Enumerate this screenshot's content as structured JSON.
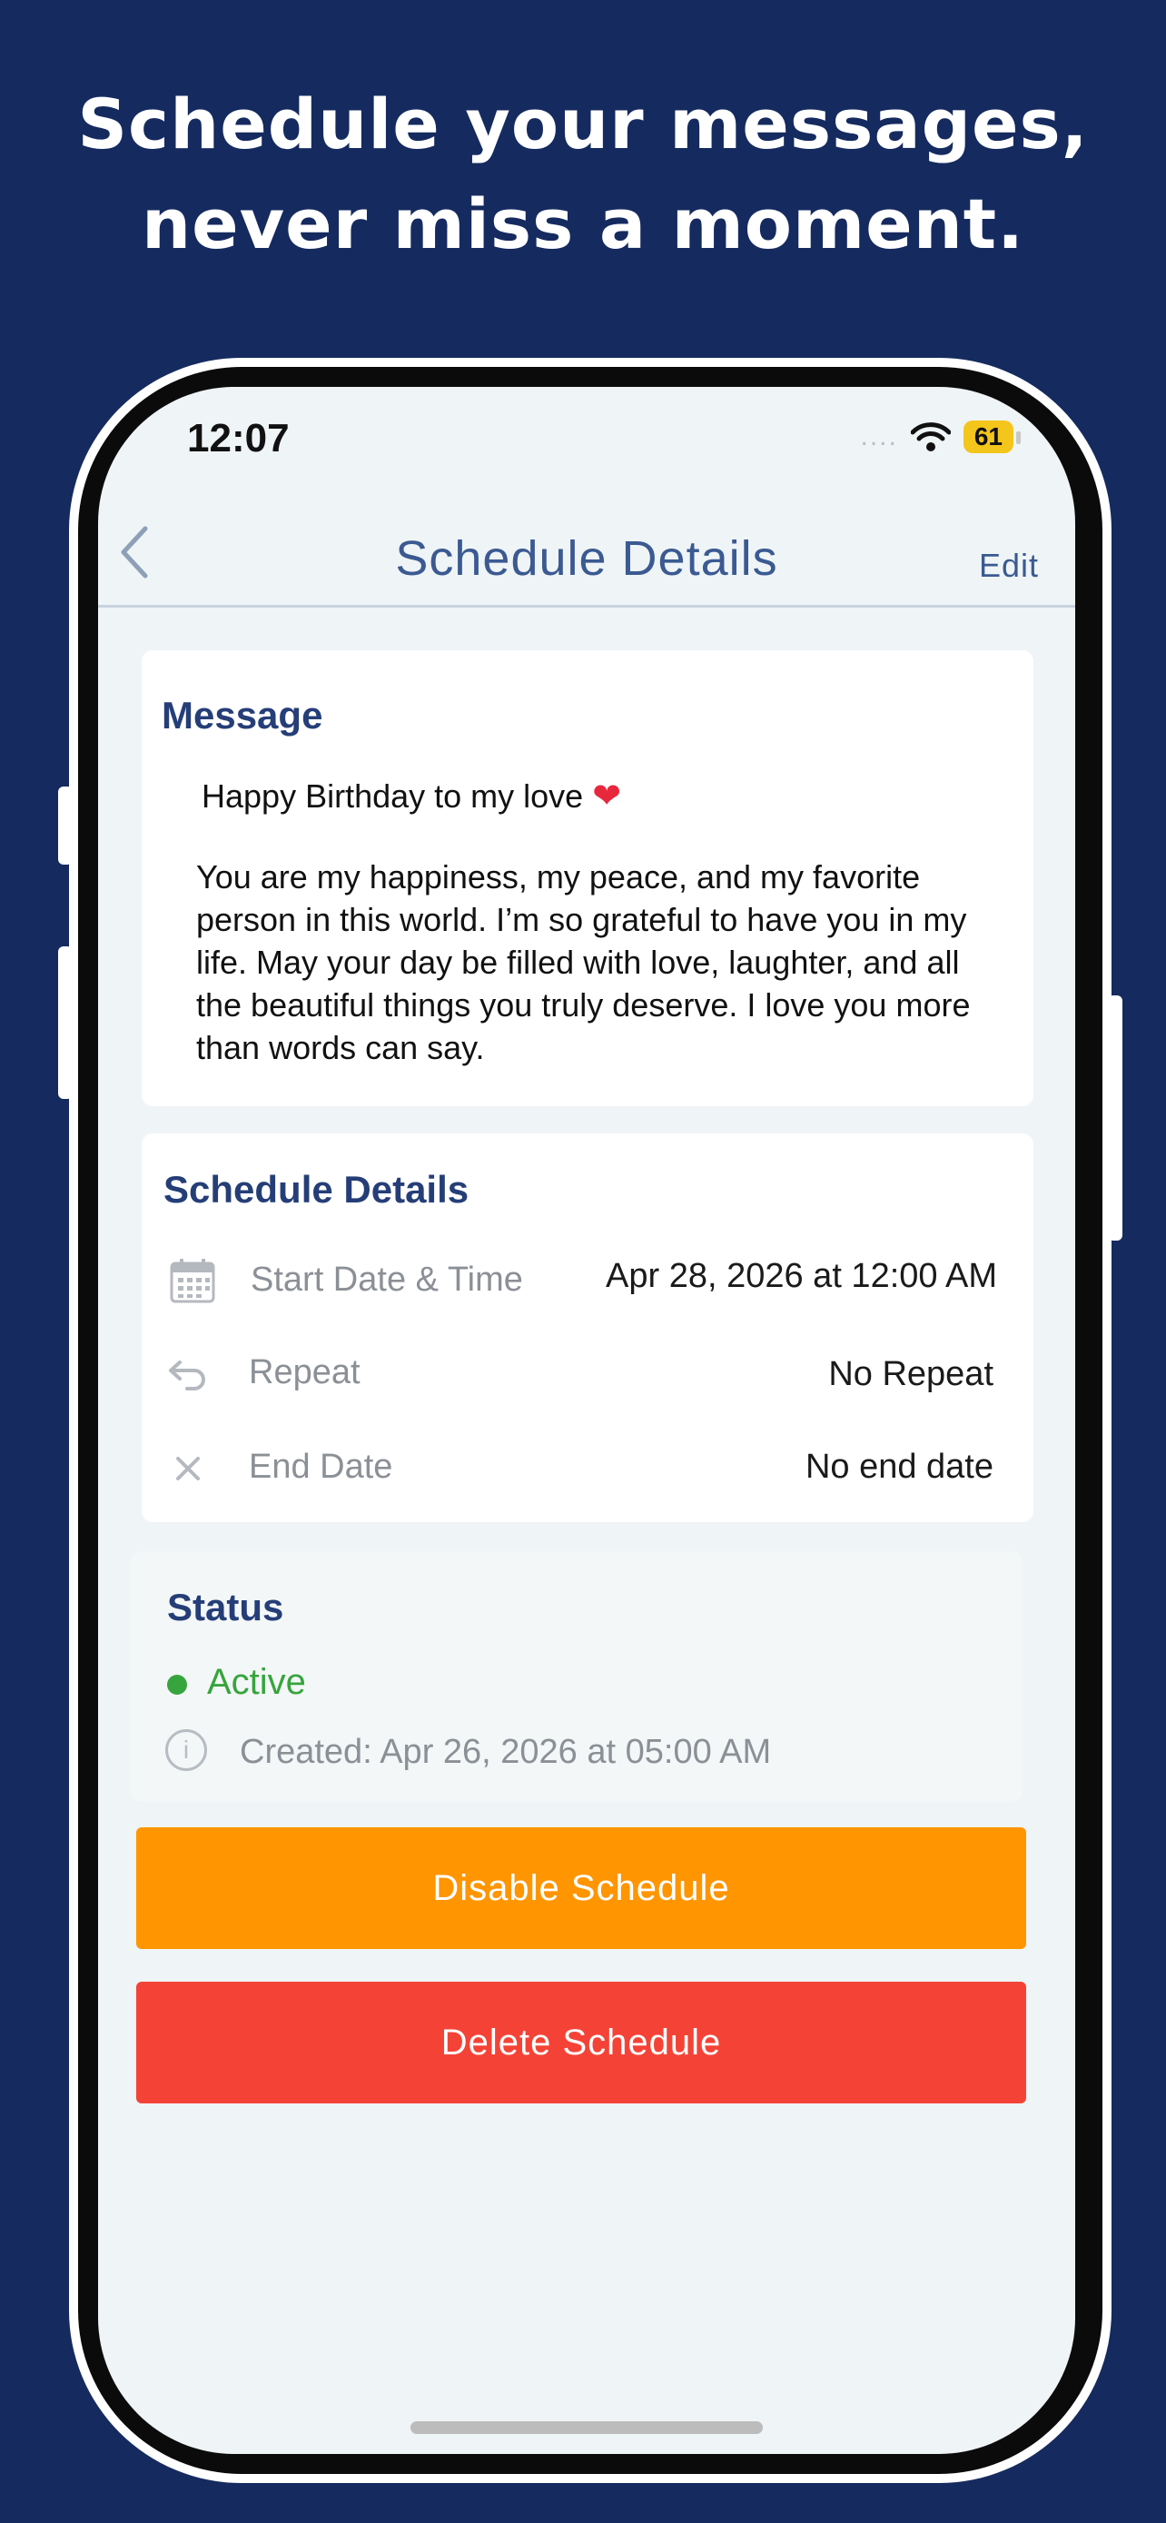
{
  "promo": {
    "headline_line1": "Schedule your messages,",
    "headline_line2": "never miss a moment."
  },
  "status_bar": {
    "time": "12:07",
    "signal": "....",
    "battery": "61"
  },
  "nav": {
    "back_icon": "chevron-left-icon",
    "title": "Schedule Details",
    "edit_label": "Edit"
  },
  "message_card": {
    "title": "Message",
    "greeting": "Happy Birthday to my love",
    "heart": "❤",
    "body": "You are my happiness, my peace, and my favorite person in this world. I’m so grateful to have you in my life. May your day be filled with love, laughter, and all the beautiful things you truly deserve. I love you more than words can say."
  },
  "schedule_card": {
    "title": "Schedule Details",
    "rows": [
      {
        "icon": "calendar-icon",
        "label": "Start Date & Time",
        "value": "Apr 28, 2026 at 12:00 AM"
      },
      {
        "icon": "repeat-icon",
        "label": "Repeat",
        "value": "No Repeat"
      },
      {
        "icon": "close-icon",
        "label": "End Date",
        "value": "No end date"
      }
    ]
  },
  "status_card": {
    "title": "Status",
    "state": "Active",
    "created": "Created: Apr 26, 2026 at 05:00 AM"
  },
  "actions": {
    "disable_label": "Disable Schedule",
    "delete_label": "Delete Schedule"
  },
  "colors": {
    "background": "#152a5f",
    "accent_text": "#253e78",
    "disable_button": "#ff9500",
    "delete_button": "#f44336",
    "active_status": "#36a53d"
  }
}
